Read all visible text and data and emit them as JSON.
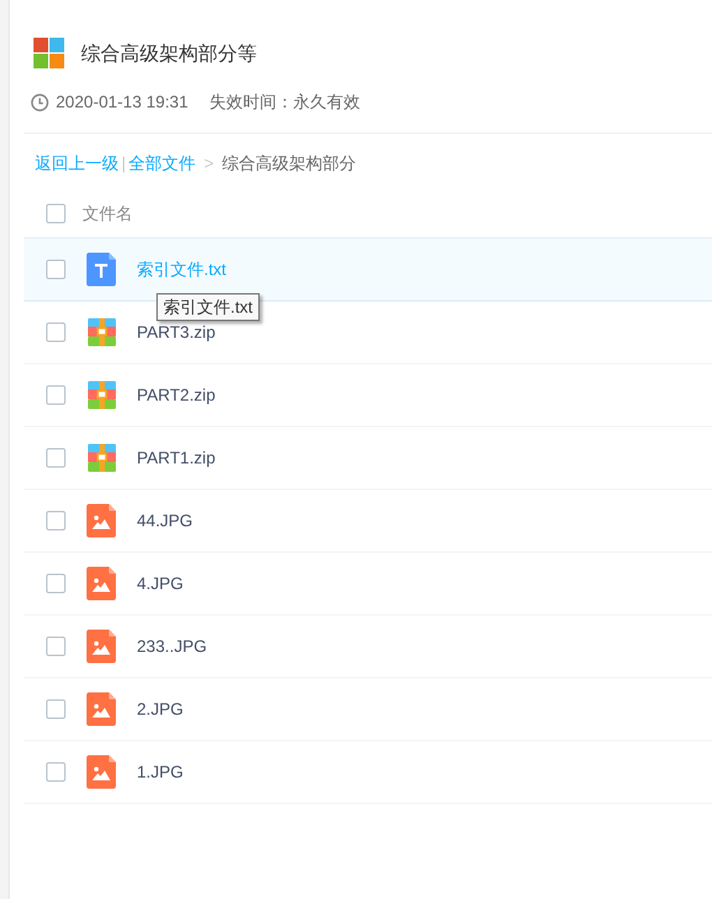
{
  "share": {
    "title": "综合高级架构部分等",
    "date": "2020-01-13 19:31",
    "expiry": "失效时间：永久有效"
  },
  "breadcrumb": {
    "back": "返回上一级",
    "separator": "|",
    "root": "全部文件",
    "arrow": ">",
    "current": "综合高级架构部分"
  },
  "table": {
    "header": {
      "checked": false,
      "label": "文件名"
    },
    "rows": [
      {
        "kind": "txt",
        "name": "索引文件.txt",
        "checked": false,
        "highlighted": true
      },
      {
        "kind": "zip",
        "name": "PART3.zip",
        "checked": false,
        "highlighted": false
      },
      {
        "kind": "zip",
        "name": "PART2.zip",
        "checked": false,
        "highlighted": false
      },
      {
        "kind": "zip",
        "name": "PART1.zip",
        "checked": false,
        "highlighted": false
      },
      {
        "kind": "image",
        "name": "44.JPG",
        "checked": false,
        "highlighted": false
      },
      {
        "kind": "image",
        "name": "4.JPG",
        "checked": false,
        "highlighted": false
      },
      {
        "kind": "image",
        "name": "233..JPG",
        "checked": false,
        "highlighted": false
      },
      {
        "kind": "image",
        "name": "2.JPG",
        "checked": false,
        "highlighted": false
      },
      {
        "kind": "image",
        "name": "1.JPG",
        "checked": false,
        "highlighted": false
      }
    ]
  },
  "tooltip": {
    "text": "索引文件.txt"
  }
}
